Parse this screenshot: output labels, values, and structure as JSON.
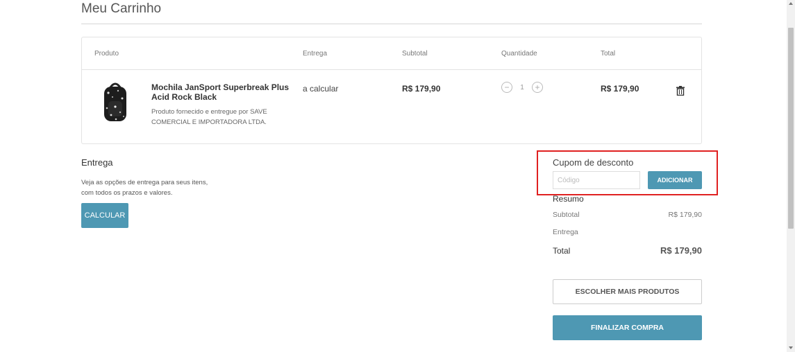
{
  "page": {
    "title": "Meu Carrinho"
  },
  "cart": {
    "columns": [
      "Produto",
      "Entrega",
      "Subtotal",
      "Quantidade",
      "Total"
    ],
    "item": {
      "name": "Mochila JanSport Superbreak Plus Acid Rock Black",
      "seller": "Produto fornecido e entregue por SAVE COMERCIAL E IMPORTADORA LTDA.",
      "delivery": "a calcular",
      "subtotal": "R$ 179,90",
      "quantity": "1",
      "total": "R$ 179,90"
    }
  },
  "shipping": {
    "title": "Entrega",
    "description": "Veja as opções de entrega para seus itens, com todos os prazos e valores.",
    "button": "CALCULAR"
  },
  "coupon": {
    "title": "Cupom de desconto",
    "placeholder": "Código",
    "value": "",
    "button": "ADICIONAR"
  },
  "summary": {
    "title": "Resumo",
    "subtotal_label": "Subtotal",
    "subtotal_value": "R$ 179,90",
    "delivery_label": "Entrega",
    "total_label": "Total",
    "total_value": "R$ 179,90"
  },
  "actions": {
    "more_products": "ESCOLHER MAIS PRODUTOS",
    "checkout": "FINALIZAR COMPRA"
  },
  "colors": {
    "accent": "#4e98b3",
    "highlight": "#e02020"
  }
}
